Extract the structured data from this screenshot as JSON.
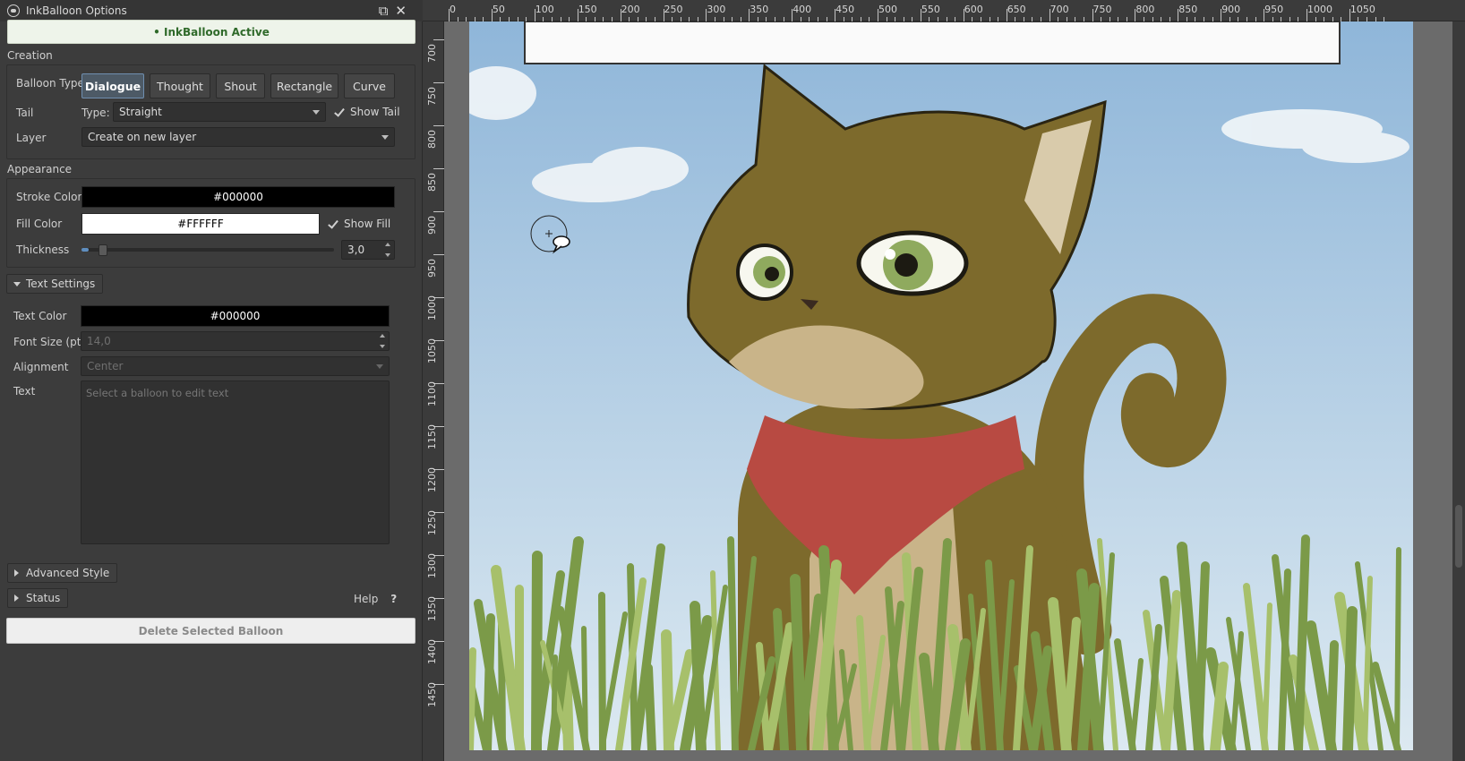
{
  "panel": {
    "title": "InkBalloon Options",
    "title_buttons": {
      "float": "⧉",
      "close": "✕"
    },
    "active_label": "• InkBalloon Active",
    "creation": {
      "section": "Creation",
      "balloon_type_label": "Balloon Type",
      "balloon_types": [
        "Dialogue",
        "Thought",
        "Shout",
        "Rectangle",
        "Curve"
      ],
      "selected_type": "Dialogue",
      "tail_label": "Tail",
      "tail_type_label": "Type:",
      "tail_type_value": "Straight",
      "show_tail_label": "Show Tail",
      "show_tail_checked": true,
      "layer_label": "Layer",
      "layer_value": "Create on new layer"
    },
    "appearance": {
      "section": "Appearance",
      "stroke_label": "Stroke Color",
      "stroke_value": "#000000",
      "fill_label": "Fill Color",
      "fill_value": "#FFFFFF",
      "show_fill_label": "Show Fill",
      "show_fill_checked": true,
      "thickness_label": "Thickness",
      "thickness_value": "3,0",
      "thickness_level": 0.03
    },
    "text_settings": {
      "toggle_label": "Text Settings",
      "text_color_label": "Text Color",
      "text_color_value": "#000000",
      "font_size_label": "Font Size (pt)",
      "font_size_value": "14,0",
      "alignment_label": "Alignment",
      "alignment_value": "Center",
      "text_label": "Text",
      "text_placeholder": "Select a balloon to edit text"
    },
    "advanced_style_label": "Advanced Style",
    "status_label": "Status",
    "help_label": "Help",
    "help_icon": "?",
    "delete_label": "Delete Selected Balloon"
  },
  "canvas": {
    "ruler_top": [
      "0",
      "50",
      "100",
      "150",
      "200",
      "250",
      "300",
      "350",
      "400",
      "450",
      "500",
      "550",
      "600",
      "650",
      "700",
      "750",
      "800",
      "850",
      "900",
      "950",
      "1000",
      "1050"
    ],
    "ruler_left": [
      "700",
      "750",
      "800",
      "850",
      "900",
      "950",
      "1000",
      "1050",
      "1100",
      "1150",
      "1200",
      "1250",
      "1300",
      "1350",
      "1400",
      "1450"
    ],
    "colors": {
      "sky_top": "#8fb6d9",
      "sky_bottom": "#dce9f1",
      "cat_body": "#7d6a2c",
      "cat_light": "#c9b489",
      "scarf": "#b84a42",
      "grass": "#7b9a48"
    },
    "cursor_icon": "speech-balloon-cursor-icon"
  }
}
